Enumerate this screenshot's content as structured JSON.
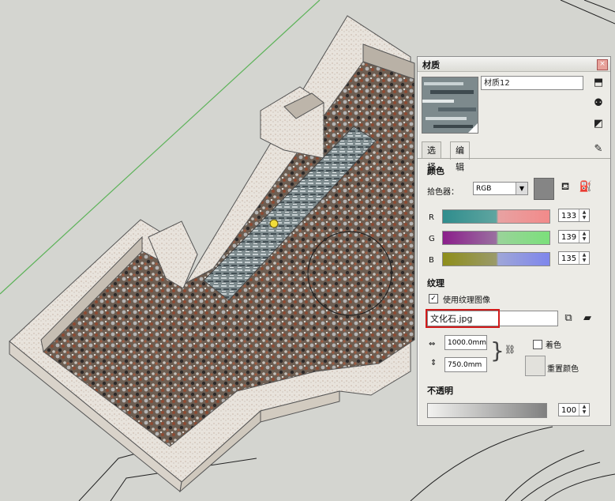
{
  "window": {
    "title": "材质"
  },
  "material": {
    "name": "材质12"
  },
  "tabs": {
    "select": "选择",
    "edit": "编辑"
  },
  "color": {
    "section": "颜色",
    "picker_label": "拾色器：",
    "picker_value": "RGB",
    "r_label": "R",
    "g_label": "G",
    "b_label": "B",
    "r": "133",
    "g": "139",
    "b": "135"
  },
  "texture": {
    "section": "纹理",
    "use_image_label": "使用纹理图像",
    "file": "文化石.jpg",
    "width": "1000.0mm",
    "height": "750.0mm",
    "colorize_label": "着色",
    "reset_label": "重置颜色"
  },
  "opacity": {
    "section": "不透明",
    "value": "100"
  },
  "colors": {
    "highlight": "#d21a1a",
    "window_bg": "#ecebe6"
  },
  "icons": {
    "close": "close-icon",
    "create": "create-material-icon",
    "sample": "sample-paint-icon",
    "toggle": "toggle-panel-icon",
    "eyedropper": "eyedropper-icon",
    "paint": "paint-bucket-icon",
    "browse": "browse-folder-icon",
    "edit_texture": "edit-texture-icon",
    "link": "aspect-link-icon"
  }
}
